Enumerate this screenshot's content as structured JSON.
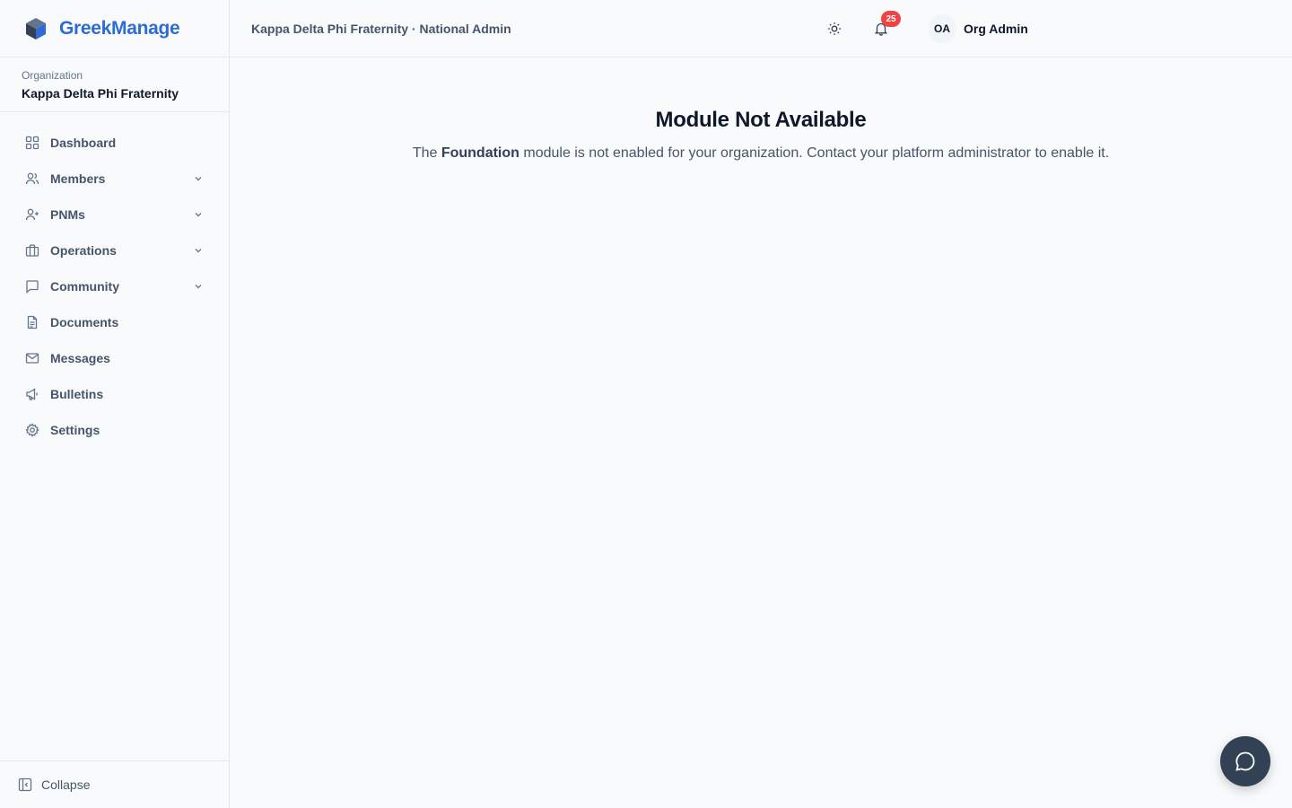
{
  "brand": {
    "name": "GreekManage",
    "color": "#2f6bd6"
  },
  "organization": {
    "label": "Organization",
    "name": "Kappa Delta Phi Fraternity"
  },
  "sidebar": {
    "items": [
      {
        "label": "Dashboard",
        "icon": "dashboard-icon",
        "expandable": false
      },
      {
        "label": "Members",
        "icon": "users-icon",
        "expandable": true
      },
      {
        "label": "PNMs",
        "icon": "user-plus-icon",
        "expandable": true
      },
      {
        "label": "Operations",
        "icon": "briefcase-icon",
        "expandable": true
      },
      {
        "label": "Community",
        "icon": "chat-icon",
        "expandable": true
      },
      {
        "label": "Documents",
        "icon": "document-icon",
        "expandable": false
      },
      {
        "label": "Messages",
        "icon": "mail-icon",
        "expandable": false
      },
      {
        "label": "Bulletins",
        "icon": "megaphone-icon",
        "expandable": false
      },
      {
        "label": "Settings",
        "icon": "gear-icon",
        "expandable": false
      }
    ],
    "collapse_label": "Collapse"
  },
  "header": {
    "title": "Kappa Delta Phi Fraternity · National Admin",
    "notification_count": "25",
    "user_initials": "OA",
    "user_name": "Org Admin"
  },
  "main": {
    "title": "Module Not Available",
    "body_prefix": "The ",
    "module_name": "Foundation",
    "body_suffix": " module is not enabled for your organization. Contact your platform administrator to enable it."
  }
}
